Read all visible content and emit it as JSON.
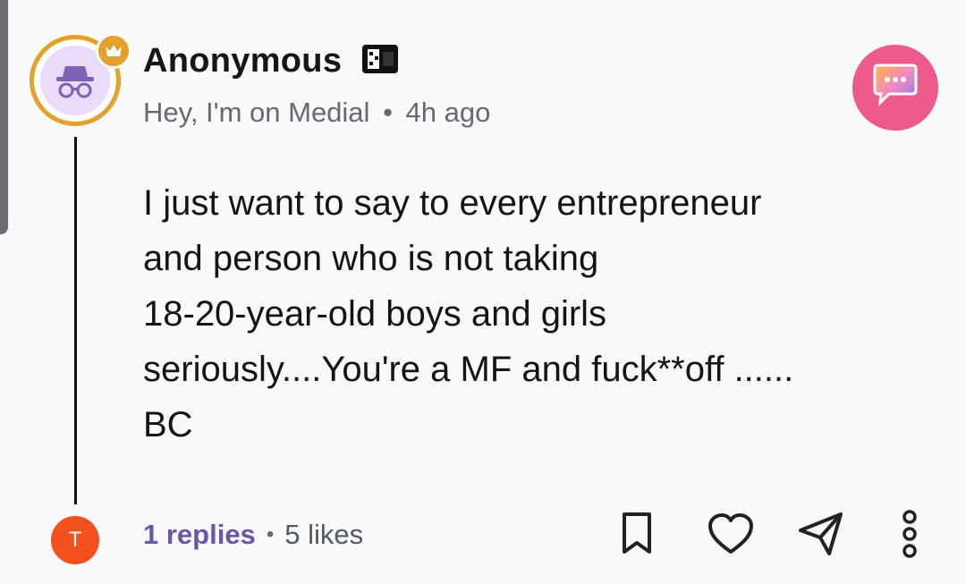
{
  "post": {
    "author": {
      "name": "Anonymous",
      "avatar_icon": "incognito-icon",
      "badge_icon": "crown-icon",
      "name_badge_icon": "mask-icon"
    },
    "subtitle": {
      "tagline": "Hey, I'm on Medial",
      "separator": "•",
      "time": "4h ago"
    },
    "body": "I just want to say to every entrepreneur\nand person who is not taking\n18-20-year-old boys and girls\nseriously....You're a MF and fuck**off ......\nBC",
    "footer": {
      "replies": "1 replies",
      "separator": "•",
      "likes": "5 likes"
    },
    "reply_avatar_initial": "T",
    "actions": [
      "bookmark-icon",
      "heart-icon",
      "share-icon",
      "more-icon"
    ]
  },
  "colors": {
    "accent_gold": "#e3a12a",
    "reply_link": "#6a56a5",
    "chat_button": "#ee5a8c",
    "reply_avatar": "#f4511e"
  }
}
